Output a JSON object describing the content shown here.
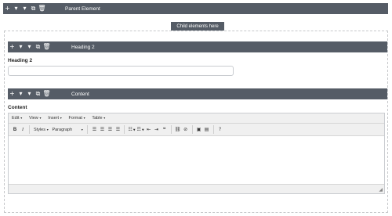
{
  "parent": {
    "title": "Parent Element",
    "tools": [
      "+",
      "▾",
      "▾",
      "⧉",
      "🗑"
    ]
  },
  "child_button": "Child elements here",
  "heading2_block": {
    "bar_title": "Heading 2",
    "field_label": "Heading 2",
    "input_value": "",
    "tools": [
      "+",
      "▾",
      "▾",
      "⧉",
      "🗑"
    ]
  },
  "content_block": {
    "bar_title": "Content",
    "field_label": "Content",
    "tools": [
      "+",
      "▾",
      "▾",
      "⧉",
      "🗑"
    ]
  },
  "editor": {
    "menus": [
      "Edit",
      "View",
      "Insert",
      "Format",
      "Table"
    ],
    "styles_label": "Styles",
    "paragraph_label": "Paragraph",
    "bold": "B",
    "italic": "I",
    "body_text": ""
  },
  "colors": {
    "bar": "#555c66",
    "toolbar_bg": "#f0f0f0",
    "border": "#c9ccd0"
  }
}
